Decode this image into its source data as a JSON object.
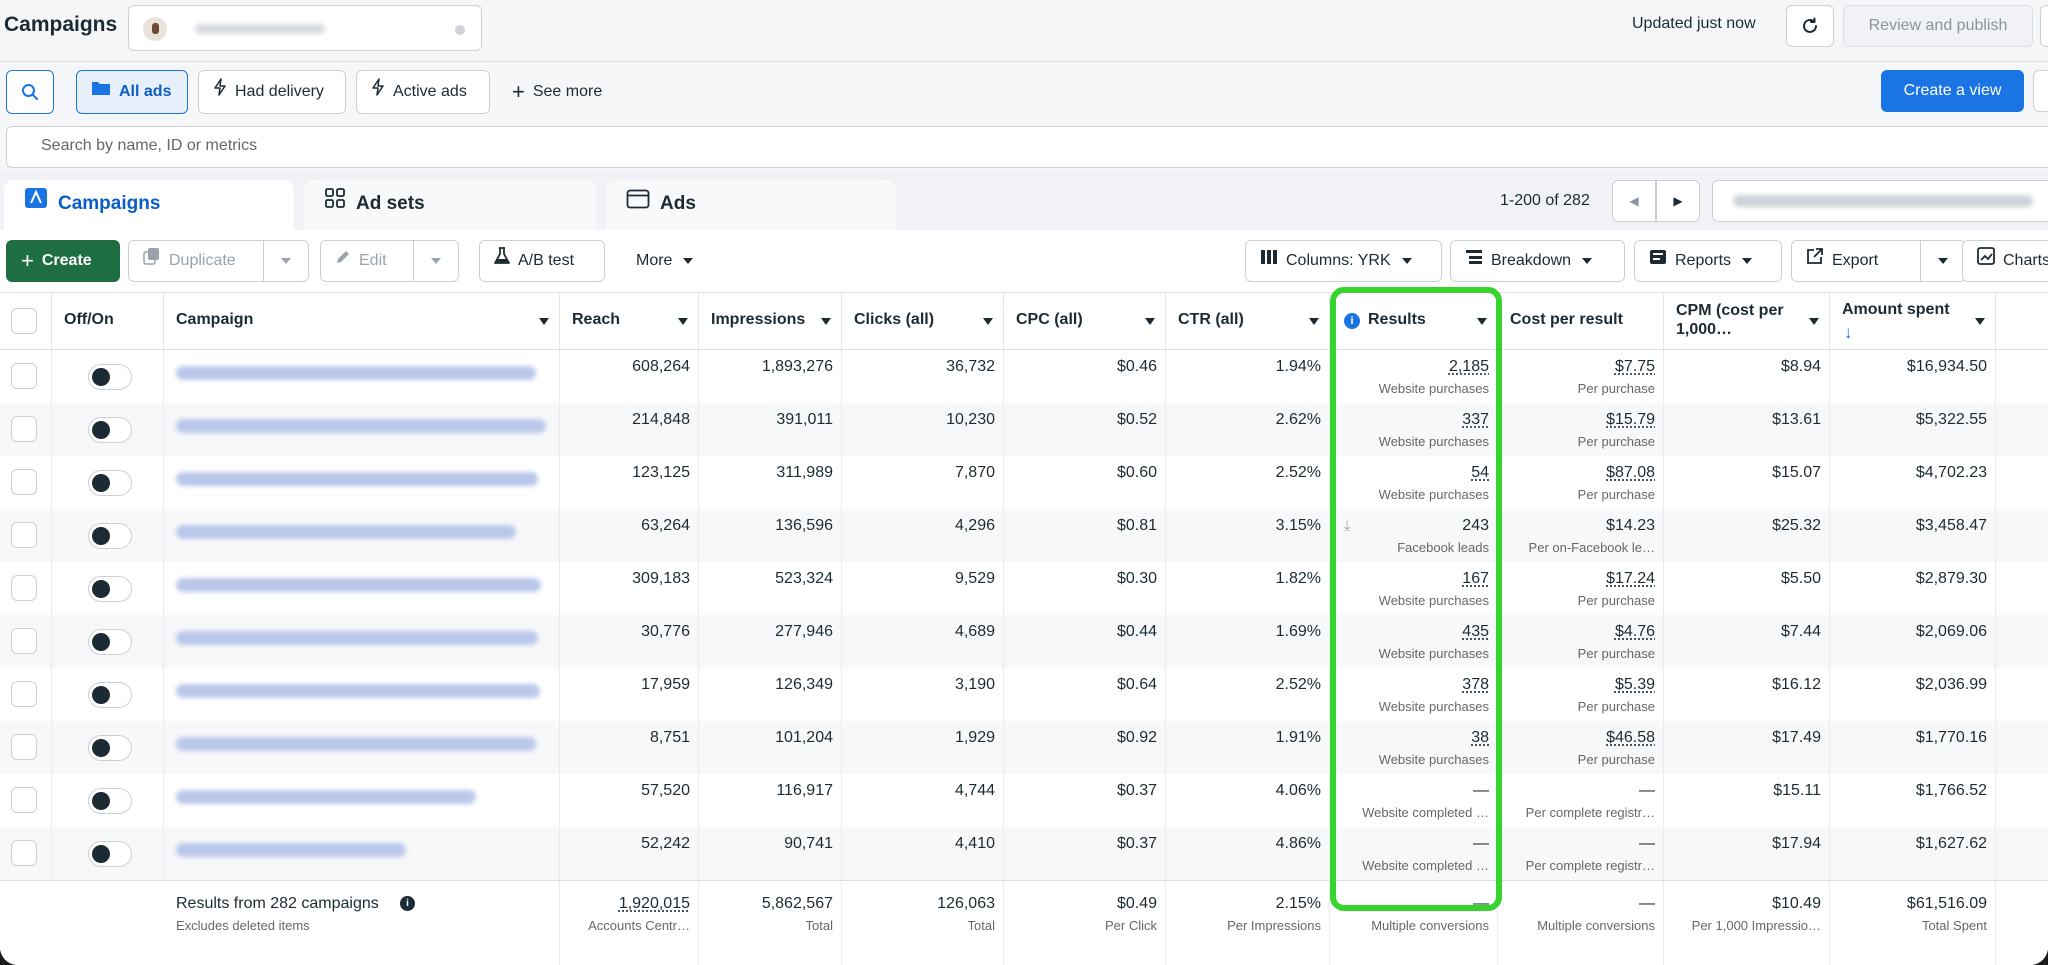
{
  "header": {
    "title": "Campaigns",
    "updated": "Updated just now",
    "review_publish": "Review and publish"
  },
  "filters": {
    "all_ads": "All ads",
    "had_delivery": "Had delivery",
    "active_ads": "Active ads",
    "see_more": "See more",
    "create_view": "Create a view",
    "search_placeholder": "Search by name, ID or metrics"
  },
  "tabs": {
    "campaigns": "Campaigns",
    "ad_sets": "Ad sets",
    "ads": "Ads",
    "pagination": "1-200 of 282"
  },
  "toolbar": {
    "create": "Create",
    "duplicate": "Duplicate",
    "edit": "Edit",
    "ab_test": "A/B test",
    "more": "More",
    "columns": "Columns: YRK",
    "breakdown": "Breakdown",
    "reports": "Reports",
    "export": "Export",
    "charts": "Charts"
  },
  "table": {
    "headers": {
      "onoff": "Off/On",
      "campaign": "Campaign",
      "reach": "Reach",
      "impressions": "Impressions",
      "clicks": "Clicks (all)",
      "cpc": "CPC (all)",
      "ctr": "CTR (all)",
      "results": "Results",
      "cost": "Cost per result",
      "cpm_line1": "CPM (cost per",
      "cpm_line2": "1,000…",
      "amount": "Amount spent"
    },
    "rows": [
      {
        "reach": "608,264",
        "impressions": "1,893,276",
        "clicks": "36,732",
        "cpc": "$0.46",
        "ctr": "1.94%",
        "results": "2,185",
        "results_sub": "Website purchases",
        "cost": "$7.75",
        "cost_sub": "Per purchase",
        "cpm": "$8.94",
        "amount": "$16,934.50"
      },
      {
        "reach": "214,848",
        "impressions": "391,011",
        "clicks": "10,230",
        "cpc": "$0.52",
        "ctr": "2.62%",
        "results": "337",
        "results_sub": "Website purchases",
        "cost": "$15.79",
        "cost_sub": "Per purchase",
        "cpm": "$13.61",
        "amount": "$5,322.55"
      },
      {
        "reach": "123,125",
        "impressions": "311,989",
        "clicks": "7,870",
        "cpc": "$0.60",
        "ctr": "2.52%",
        "results": "54",
        "results_sub": "Website purchases",
        "cost": "$87.08",
        "cost_sub": "Per purchase",
        "cpm": "$15.07",
        "amount": "$4,702.23"
      },
      {
        "reach": "63,264",
        "impressions": "136,596",
        "clicks": "4,296",
        "cpc": "$0.81",
        "ctr": "3.15%",
        "results": "243",
        "results_sub": "Facebook leads",
        "cost": "$14.23",
        "cost_sub": "Per on-Facebook le…",
        "cpm": "$25.32",
        "amount": "$3,458.47"
      },
      {
        "reach": "309,183",
        "impressions": "523,324",
        "clicks": "9,529",
        "cpc": "$0.30",
        "ctr": "1.82%",
        "results": "167",
        "results_sub": "Website purchases",
        "cost": "$17.24",
        "cost_sub": "Per purchase",
        "cpm": "$5.50",
        "amount": "$2,879.30"
      },
      {
        "reach": "30,776",
        "impressions": "277,946",
        "clicks": "4,689",
        "cpc": "$0.44",
        "ctr": "1.69%",
        "results": "435",
        "results_sub": "Website purchases",
        "cost": "$4.76",
        "cost_sub": "Per purchase",
        "cpm": "$7.44",
        "amount": "$2,069.06"
      },
      {
        "reach": "17,959",
        "impressions": "126,349",
        "clicks": "3,190",
        "cpc": "$0.64",
        "ctr": "2.52%",
        "results": "378",
        "results_sub": "Website purchases",
        "cost": "$5.39",
        "cost_sub": "Per purchase",
        "cpm": "$16.12",
        "amount": "$2,036.99"
      },
      {
        "reach": "8,751",
        "impressions": "101,204",
        "clicks": "1,929",
        "cpc": "$0.92",
        "ctr": "1.91%",
        "results": "38",
        "results_sub": "Website purchases",
        "cost": "$46.58",
        "cost_sub": "Per purchase",
        "cpm": "$17.49",
        "amount": "$1,770.16"
      },
      {
        "reach": "57,520",
        "impressions": "116,917",
        "clicks": "4,744",
        "cpc": "$0.37",
        "ctr": "4.06%",
        "results": "—",
        "results_sub": "Website completed …",
        "cost": "—",
        "cost_sub": "Per complete registr…",
        "cpm": "$15.11",
        "amount": "$1,766.52"
      },
      {
        "reach": "52,242",
        "impressions": "90,741",
        "clicks": "4,410",
        "cpc": "$0.37",
        "ctr": "4.86%",
        "results": "—",
        "results_sub": "Website completed …",
        "cost": "—",
        "cost_sub": "Per complete registr…",
        "cpm": "$17.94",
        "amount": "$1,627.62"
      }
    ],
    "footer": {
      "label": "Results from 282 campaigns",
      "label_sub": "Excludes deleted items",
      "reach": "1,920,015",
      "reach_sub": "Accounts Centr…",
      "impressions": "5,862,567",
      "impressions_sub": "Total",
      "clicks": "126,063",
      "clicks_sub": "Total",
      "cpc": "$0.49",
      "cpc_sub": "Per Click",
      "ctr": "2.15%",
      "ctr_sub": "Per Impressions",
      "results": "—",
      "results_sub": "Multiple conversions",
      "cost": "—",
      "cost_sub": "Multiple conversions",
      "cpm": "$10.49",
      "cpm_sub": "Per 1,000 Impressio…",
      "amount": "$61,516.09",
      "amount_sub": "Total Spent"
    }
  },
  "colors": {
    "highlight": "#36d42c",
    "primary_blue": "#1b74e4",
    "create_green": "#1f6e43"
  }
}
